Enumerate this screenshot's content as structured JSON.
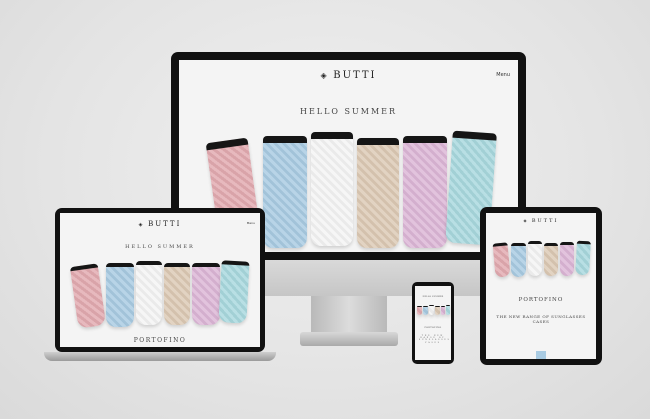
{
  "brand": "BUTTI",
  "menu_label": "Menu",
  "desktop": {
    "headline": "HELLO SUMMER"
  },
  "laptop": {
    "headline": "HELLO SUMMER",
    "section_title": "PORTOFINO"
  },
  "tablet": {
    "section_title": "PORTOFINO",
    "subtitle": "THE NEW RANGE OF SUNGLASSES CASES"
  },
  "phone": {
    "headline": "HELLO SUMMER",
    "section_title": "PORTOFINO",
    "subtitle": "THE NEW RANGE OF SUNGLASSES CASES"
  },
  "colors": {
    "cases": [
      "#e2aab0",
      "#a9cbe2",
      "#f4f4f4",
      "#dcc9b4",
      "#dcb6d6",
      "#a9d8de"
    ],
    "cap": "#151515",
    "screen_bg": "#f4f4f4"
  }
}
